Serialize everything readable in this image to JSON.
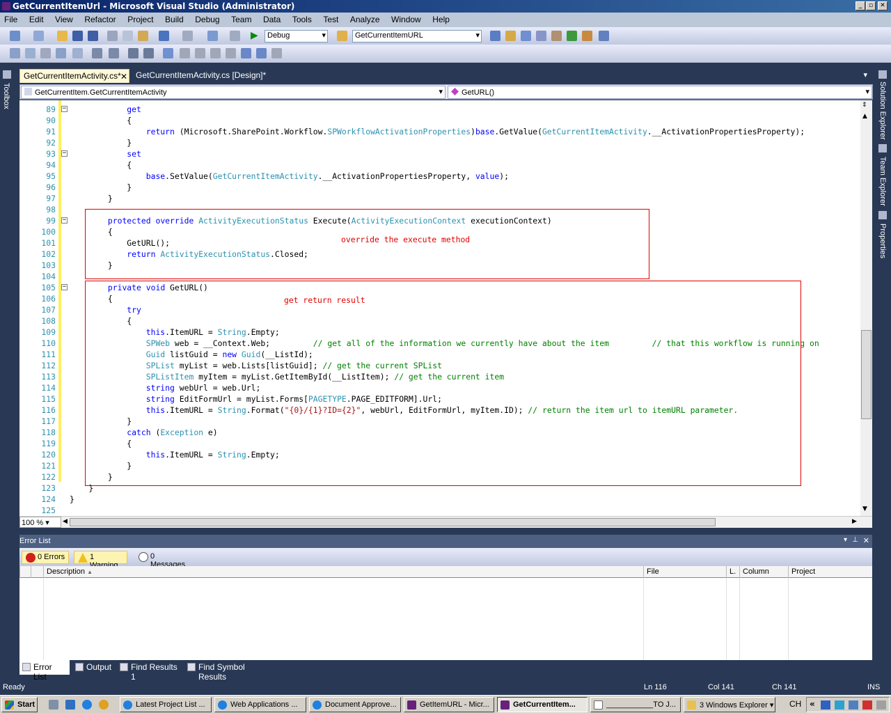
{
  "window": {
    "title": "GetCurrentItemUrl - Microsoft Visual Studio (Administrator)"
  },
  "menu": [
    "File",
    "Edit",
    "View",
    "Refactor",
    "Project",
    "Build",
    "Debug",
    "Team",
    "Data",
    "Tools",
    "Test",
    "Analyze",
    "Window",
    "Help"
  ],
  "toolbar": {
    "config": "Debug",
    "find_combo": "GetCurrentItemURL"
  },
  "tabs": [
    {
      "label": "GetCurrentItemActivity.cs*",
      "active": true
    },
    {
      "label": "GetCurrentItemActivity.cs [Design]*",
      "active": false
    }
  ],
  "side_left": {
    "toolbox": "Toolbox"
  },
  "side_right": {
    "solution_explorer": "Solution Explorer",
    "team_explorer": "Team Explorer",
    "properties": "Properties"
  },
  "navbar": {
    "class_combo": "GetCurrentItem.GetCurrentItemActivity",
    "member_combo": "GetURL()"
  },
  "editor": {
    "zoom": "100 %",
    "lines": [
      {
        "n": "89",
        "fold": true,
        "html": "            <span class='kw'>get</span>"
      },
      {
        "n": "90",
        "html": "            {"
      },
      {
        "n": "91",
        "html": "                <span class='kw'>return</span> (Microsoft.SharePoint.Workflow.<span class='ty'>SPWorkflowActivationProperties</span>)<span class='kw'>base</span>.GetValue(<span class='ty'>GetCurrentItemActivity</span>.__ActivationPropertiesProperty);"
      },
      {
        "n": "92",
        "html": "            }"
      },
      {
        "n": "93",
        "fold": true,
        "html": "            <span class='kw'>set</span>"
      },
      {
        "n": "94",
        "html": "            {"
      },
      {
        "n": "95",
        "html": "                <span class='kw'>base</span>.SetValue(<span class='ty'>GetCurrentItemActivity</span>.__ActivationPropertiesProperty, <span class='kw'>value</span>);"
      },
      {
        "n": "96",
        "html": "            }"
      },
      {
        "n": "97",
        "html": "        }"
      },
      {
        "n": "98",
        "html": ""
      },
      {
        "n": "99",
        "fold": true,
        "html": "        <span class='kw'>protected</span> <span class='kw'>override</span> <span class='ty'>ActivityExecutionStatus</span> Execute(<span class='ty'>ActivityExecutionContext</span> executionContext)"
      },
      {
        "n": "100",
        "html": "        {"
      },
      {
        "n": "101",
        "html": "            GetURL();"
      },
      {
        "n": "102",
        "html": "            <span class='kw'>return</span> <span class='ty'>ActivityExecutionStatus</span>.Closed;"
      },
      {
        "n": "103",
        "html": "        }"
      },
      {
        "n": "104",
        "html": ""
      },
      {
        "n": "105",
        "fold": true,
        "html": "        <span class='kw'>private</span> <span class='kw'>void</span> GetURL()"
      },
      {
        "n": "106",
        "html": "        {"
      },
      {
        "n": "107",
        "html": "            <span class='kw'>try</span>"
      },
      {
        "n": "108",
        "html": "            {"
      },
      {
        "n": "109",
        "html": "                <span class='kw'>this</span>.ItemURL = <span class='ty'>String</span>.Empty;"
      },
      {
        "n": "110",
        "html": "                <span class='ty'>SPWeb</span> web = __Context.Web;         <span class='cm'>// get all of the information we currently have about the item         // that this workflow is running on</span>"
      },
      {
        "n": "111",
        "html": "                <span class='ty'>Guid</span> listGuid = <span class='kw'>new</span> <span class='ty'>Guid</span>(__ListId);"
      },
      {
        "n": "112",
        "html": "                <span class='ty'>SPList</span> myList = web.Lists[listGuid]; <span class='cm'>// get the current SPList</span>"
      },
      {
        "n": "113",
        "html": "                <span class='ty'>SPListItem</span> myItem = myList.GetItemById(__ListItem); <span class='cm'>// get the current item</span>"
      },
      {
        "n": "114",
        "html": "                <span class='kw'>string</span> webUrl = web.Url;"
      },
      {
        "n": "115",
        "html": "                <span class='kw'>string</span> EditFormUrl = myList.Forms[<span class='ty'>PAGETYPE</span>.PAGE_EDITFORM].Url;"
      },
      {
        "n": "116",
        "html": "                <span class='kw'>this</span>.ItemURL = <span class='ty'>String</span>.Format(<span class='st'>\"{0}/{1}?ID={2}\"</span>, webUrl, EditFormUrl, myItem.ID); <span class='cm'>// return the item url to itemURL parameter.</span>"
      },
      {
        "n": "117",
        "html": "            }"
      },
      {
        "n": "118",
        "html": "            <span class='kw'>catch</span> (<span class='ty'>Exception</span> e)"
      },
      {
        "n": "119",
        "html": "            {"
      },
      {
        "n": "120",
        "html": "                <span class='kw'>this</span>.ItemURL = <span class='ty'>String</span>.Empty;"
      },
      {
        "n": "121",
        "html": "            }"
      },
      {
        "n": "122",
        "html": "        }"
      },
      {
        "n": "123",
        "html": "    }"
      },
      {
        "n": "124",
        "html": "}"
      },
      {
        "n": "125",
        "html": ""
      }
    ],
    "annotations": {
      "execute": "override the execute method",
      "geturl": "get return result"
    }
  },
  "error_list": {
    "title": "Error List",
    "errors": "0 Errors",
    "warnings": "1 Warning",
    "messages": "0 Messages",
    "columns": [
      "Description",
      "File",
      "L.",
      "Column",
      "Project"
    ]
  },
  "bottom_tabs": [
    "Error List",
    "Output",
    "Find Results 1",
    "Find Symbol Results"
  ],
  "status": {
    "state": "Ready",
    "ln": "Ln 116",
    "col": "Col 141",
    "ch": "Ch 141",
    "ins": "INS"
  },
  "taskbar": {
    "start": "Start",
    "items": [
      "Latest Project List ...",
      "Web Applications ...",
      "Document Approve...",
      "GetItemURL - Micr...",
      "GetCurrentItem...",
      "___________TO J...",
      "3 Windows Explorer"
    ],
    "lang": "CH"
  }
}
